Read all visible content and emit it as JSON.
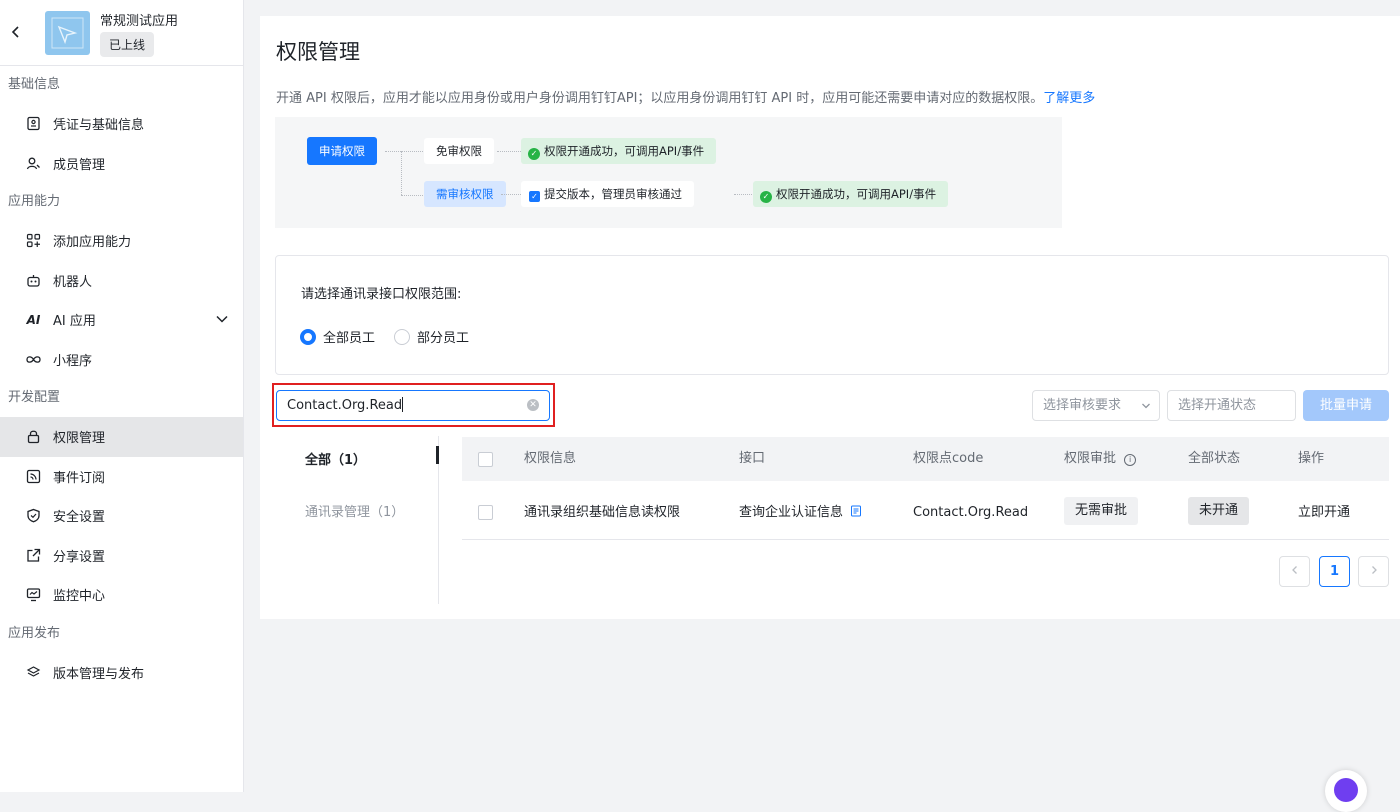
{
  "app": {
    "name": "常规测试应用",
    "status": "已上线"
  },
  "sidebar": {
    "groups": [
      {
        "label": "基础信息",
        "items": [
          {
            "label": "凭证与基础信息"
          },
          {
            "label": "成员管理"
          }
        ]
      },
      {
        "label": "应用能力",
        "items": [
          {
            "label": "添加应用能力"
          },
          {
            "label": "机器人"
          },
          {
            "label": "AI 应用"
          },
          {
            "label": "小程序"
          }
        ]
      },
      {
        "label": "开发配置",
        "items": [
          {
            "label": "权限管理"
          },
          {
            "label": "事件订阅"
          },
          {
            "label": "安全设置"
          },
          {
            "label": "分享设置"
          },
          {
            "label": "监控中心"
          }
        ]
      },
      {
        "label": "应用发布",
        "items": [
          {
            "label": "版本管理与发布"
          }
        ]
      }
    ]
  },
  "page": {
    "title": "权限管理",
    "description": "开通 API 权限后，应用才能以应用身份或用户身份调用钉钉API；以应用身份调用钉钉 API 时，应用可能还需要申请对应的数据权限。",
    "learn_more": "了解更多"
  },
  "flow": {
    "apply": "申请权限",
    "no_review": "免审权限",
    "no_review_result": "权限开通成功，可调用API/事件",
    "need_review": "需审核权限",
    "submit": "提交版本，管理员审核通过",
    "need_review_result": "权限开通成功，可调用API/事件"
  },
  "scope": {
    "label": "请选择通讯录接口权限范围:",
    "options": [
      "全部员工",
      "部分员工"
    ],
    "selected": "全部员工"
  },
  "filters": {
    "search_value": "Contact.Org.Read",
    "review_placeholder": "选择审核要求",
    "status_placeholder": "选择开通状态",
    "batch_button": "批量申请"
  },
  "category_tabs": [
    {
      "label": "全部（1）",
      "active": true
    },
    {
      "label": "通讯录管理（1）",
      "active": false
    }
  ],
  "table": {
    "headers": [
      "权限信息",
      "接口",
      "权限点code",
      "权限审批",
      "全部状态",
      "操作"
    ],
    "rows": [
      {
        "info": "通讯录组织基础信息读权限",
        "api": "查询企业认证信息",
        "code": "Contact.Org.Read",
        "approval": "无需审批",
        "status": "未开通",
        "action": "立即开通"
      }
    ]
  },
  "pagination": {
    "current": "1"
  },
  "colors": {
    "primary": "#1677ff",
    "success": "#27b346",
    "highlight_border": "#e02020"
  }
}
